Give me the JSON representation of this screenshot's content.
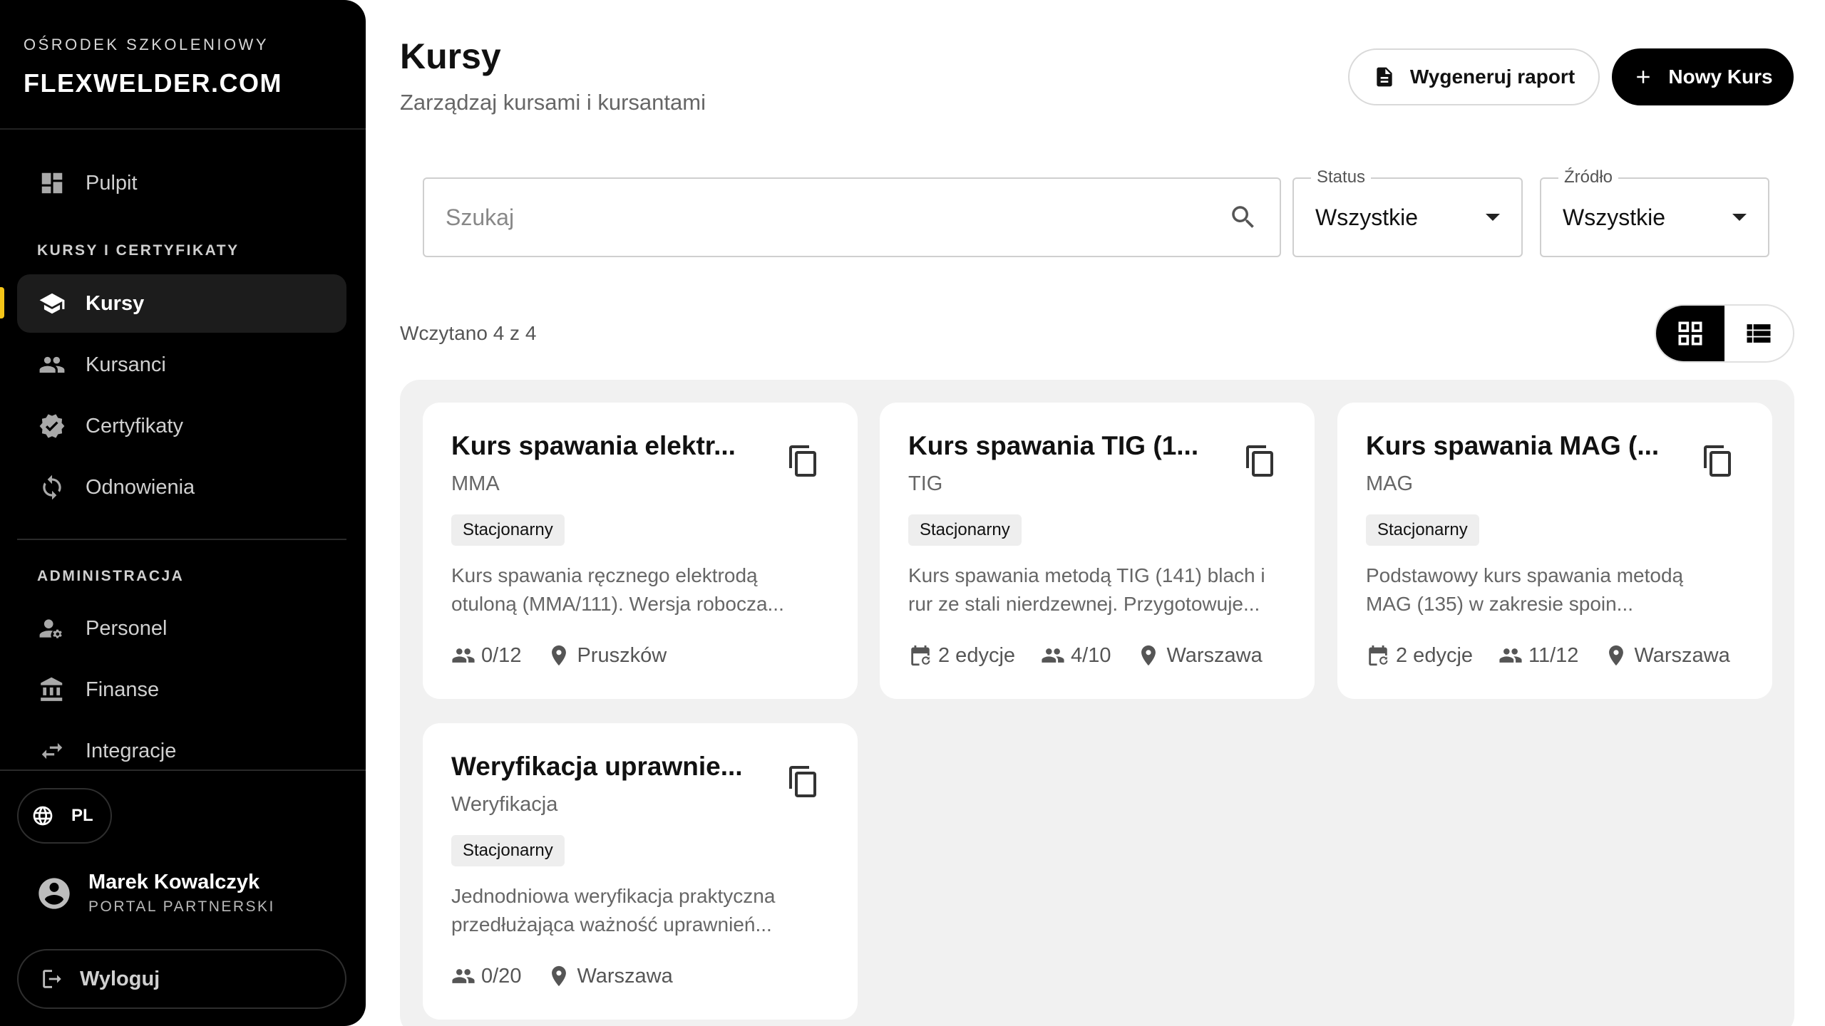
{
  "brand": {
    "subtitle": "OŚRODEK SZKOLENIOWY",
    "name": "FLEXWELDER.COM"
  },
  "sidebar": {
    "items": [
      {
        "label": "Pulpit",
        "icon": "dashboard-icon"
      },
      {
        "label": "Kursy",
        "icon": "school-icon",
        "active": true
      },
      {
        "label": "Kursanci",
        "icon": "people-icon"
      },
      {
        "label": "Certyfikaty",
        "icon": "verified-badge-icon"
      },
      {
        "label": "Odnowienia",
        "icon": "renew-icon"
      },
      {
        "label": "Personel",
        "icon": "staff-icon"
      },
      {
        "label": "Finanse",
        "icon": "bank-icon"
      },
      {
        "label": "Integracje",
        "icon": "swap-arrows-icon"
      }
    ],
    "sections": {
      "courses": "KURSY I CERTYFIKATY",
      "admin": "ADMINISTRACJA"
    },
    "accent_color": "#f5c518",
    "language": "PL",
    "user": {
      "name": "Marek Kowalczyk",
      "role": "PORTAL PARTNERSKI"
    },
    "logout_label": "Wyloguj"
  },
  "header": {
    "title": "Kursy",
    "subtitle": "Zarządzaj kursami i kursantami",
    "report_button": "Wygeneruj raport",
    "new_button": "Nowy Kurs"
  },
  "filters": {
    "search_placeholder": "Szukaj",
    "status": {
      "label": "Status",
      "value": "Wszystkie"
    },
    "source": {
      "label": "Źródło",
      "value": "Wszystkie"
    }
  },
  "results": {
    "loaded_text": "Wczytano 4 z 4",
    "view_mode": "grid"
  },
  "courses": [
    {
      "title": "Kurs spawania elektr...",
      "type": "MMA",
      "mode": "Stacjonarny",
      "desc_line1": "Kurs spawania ręcznego elektrodą",
      "desc_line2": "otuloną (MMA/111). Wersja robocza...",
      "participants": "0/12",
      "location": "Pruszków"
    },
    {
      "title": "Kurs spawania TIG (1...",
      "type": "TIG",
      "mode": "Stacjonarny",
      "desc_line1": "Kurs spawania metodą TIG (141) blach i",
      "desc_line2": "rur ze stali nierdzewnej. Przygotowuje...",
      "editions": "2 edycje",
      "participants": "4/10",
      "location": "Warszawa"
    },
    {
      "title": "Kurs spawania MAG (...",
      "type": "MAG",
      "mode": "Stacjonarny",
      "desc_line1": "Podstawowy kurs spawania metodą",
      "desc_line2": "MAG (135) w zakresie spoin...",
      "editions": "2 edycje",
      "participants": "11/12",
      "location": "Warszawa"
    },
    {
      "title": "Weryfikacja uprawnie...",
      "type": "Weryfikacja",
      "mode": "Stacjonarny",
      "desc_line1": "Jednodniowa weryfikacja praktyczna",
      "desc_line2": "przedłużająca ważność uprawnień...",
      "participants": "0/20",
      "location": "Warszawa"
    }
  ]
}
